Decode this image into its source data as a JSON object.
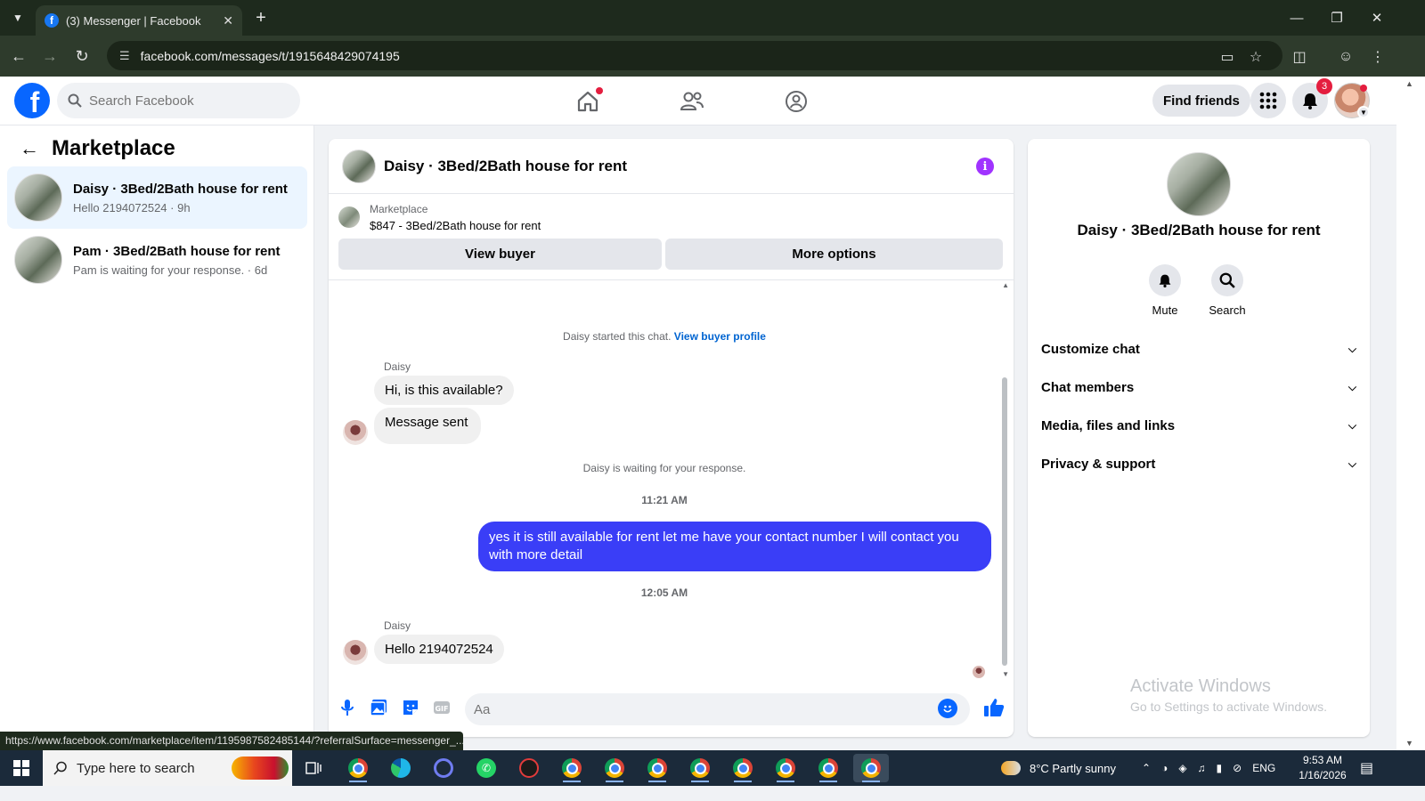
{
  "browser": {
    "tab_title": "(3) Messenger | Facebook",
    "url": "facebook.com/messages/t/1915648429074195",
    "status_url": "https://www.facebook.com/marketplace/item/1195987582485144/?referralSurface=messenger_..."
  },
  "header": {
    "search_placeholder": "Search Facebook",
    "find_friends": "Find friends",
    "notification_count": "3"
  },
  "sidebar": {
    "title": "Marketplace",
    "conversations": [
      {
        "title": "Daisy · 3Bed/2Bath house for rent",
        "subtitle": "Hello 2194072524 · 9h",
        "active": true
      },
      {
        "title": "Pam · 3Bed/2Bath house for rent",
        "subtitle": "Pam is waiting for your response. · 6d",
        "active": false
      }
    ]
  },
  "chat": {
    "title": "Daisy · 3Bed/2Bath house for rent",
    "marketplace_label": "Marketplace",
    "listing": "$847 - 3Bed/2Bath house for rent",
    "view_buyer": "View buyer",
    "more_options": "More options",
    "started_text": "Daisy started this chat.",
    "view_buyer_profile": "View buyer profile",
    "sender": "Daisy",
    "msg1": "Hi, is this available?",
    "msg2": "Message sent",
    "waiting": "Daisy is waiting for your response.",
    "time1": "11:21 AM",
    "out_msg": "yes it is still available for rent let me have your contact number I will contact you with more detail",
    "time2": "12:05 AM",
    "msg3": "Hello 2194072524",
    "composer_placeholder": "Aa"
  },
  "details": {
    "title": "Daisy · 3Bed/2Bath house for rent",
    "mute": "Mute",
    "search": "Search",
    "rows": [
      "Customize chat",
      "Chat members",
      "Media, files and links",
      "Privacy & support"
    ]
  },
  "watermark": {
    "line1": "Activate Windows",
    "line2": "Go to Settings to activate Windows."
  },
  "taskbar": {
    "search_placeholder": "Type here to search",
    "weather": "8°C  Partly sunny",
    "lang": "ENG",
    "time": "9:53 AM",
    "date": "1/16/2026"
  },
  "colors": {
    "facebook_blue": "#0866ff",
    "outgoing_bubble": "#3a3ef7",
    "active_conversation": "#ebf5ff",
    "notification_red": "#e41e3f"
  }
}
